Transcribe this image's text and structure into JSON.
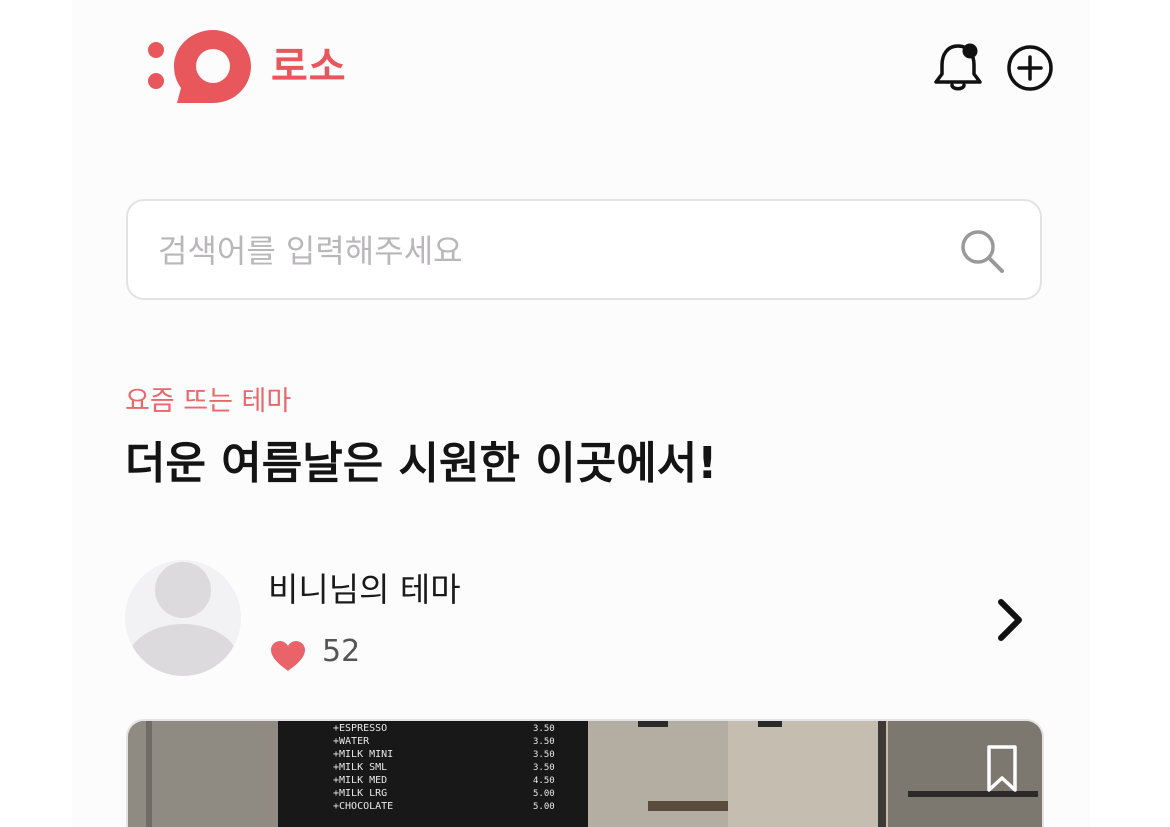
{
  "header": {
    "logo_text": "로소",
    "brand_color": "#e8575c",
    "icons": [
      "logo-icon",
      "bell-icon",
      "add-circle-icon"
    ],
    "has_notification": true
  },
  "search": {
    "placeholder": "검색어를 입력해주세요",
    "value": "",
    "icon": "search-icon"
  },
  "section": {
    "label": "요즘 뜨는 테마",
    "title": "더운 여름날은 시원한 이곳에서!",
    "label_color": "#e8686b"
  },
  "theme": {
    "author_name": "비니님의 테마",
    "like_count": "52",
    "icons": [
      "avatar-placeholder-icon",
      "heart-icon",
      "chevron-right-icon",
      "bookmark-icon"
    ]
  },
  "card_photo": {
    "menu_items": [
      "ESPRESSO",
      "WATER",
      "MILK MINI",
      "MILK SML",
      "MILK MED",
      "MILK LRG",
      "CHOCOLATE"
    ],
    "menu_prices": [
      "3.50",
      "3.50",
      "3.50",
      "3.50",
      "4.50",
      "5.00",
      "5.00"
    ]
  }
}
